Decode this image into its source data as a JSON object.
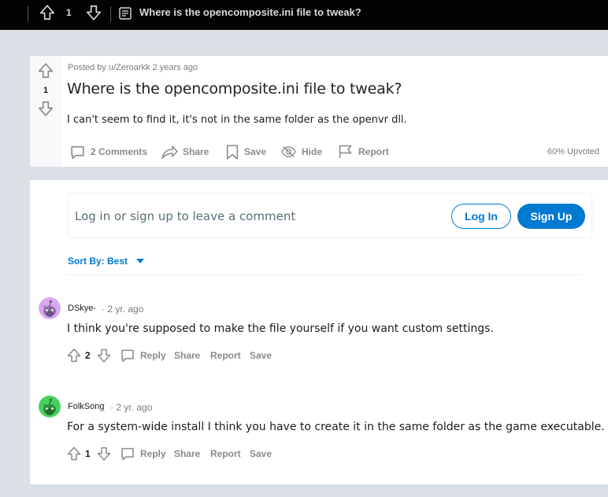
{
  "topbar": {
    "vote_count": "1",
    "title": "Where is the opencomposite.ini file to tweak?"
  },
  "post": {
    "vote_count": "1",
    "meta": "Posted by u/Zeroarkk 2 years ago",
    "title": "Where is the opencomposite.ini file to tweak?",
    "body": "I can't seem to find it, it's not in the same folder as the openvr dll.",
    "actions": {
      "comments": "2 Comments",
      "share": "Share",
      "save": "Save",
      "hide": "Hide",
      "report": "Report"
    },
    "upvoted": "60% Upvoted"
  },
  "comment_box": {
    "prompt": "Log in or sign up to leave a comment",
    "login_label": "Log In",
    "signup_label": "Sign Up"
  },
  "sort": {
    "label": "Sort By: Best"
  },
  "comments": [
    {
      "author": "DSkye-",
      "time": "2 yr. ago",
      "body": "I think you're supposed to make the file yourself if you want custom settings.",
      "votes": "2",
      "reply": "Reply",
      "share": "Share",
      "report": "Report",
      "save": "Save",
      "avatar_color": "#d9a8f0"
    },
    {
      "author": "FolkSong",
      "time": "2 yr. ago",
      "body": "For a system-wide install I think you have to create it in the same folder as the game executable.",
      "votes": "1",
      "reply": "Reply",
      "share": "Share",
      "report": "Report",
      "save": "Save",
      "avatar_color": "#46d160"
    }
  ],
  "colors": {
    "accent": "#0079d3",
    "background": "#dae0e6",
    "topbar": "#030303"
  }
}
